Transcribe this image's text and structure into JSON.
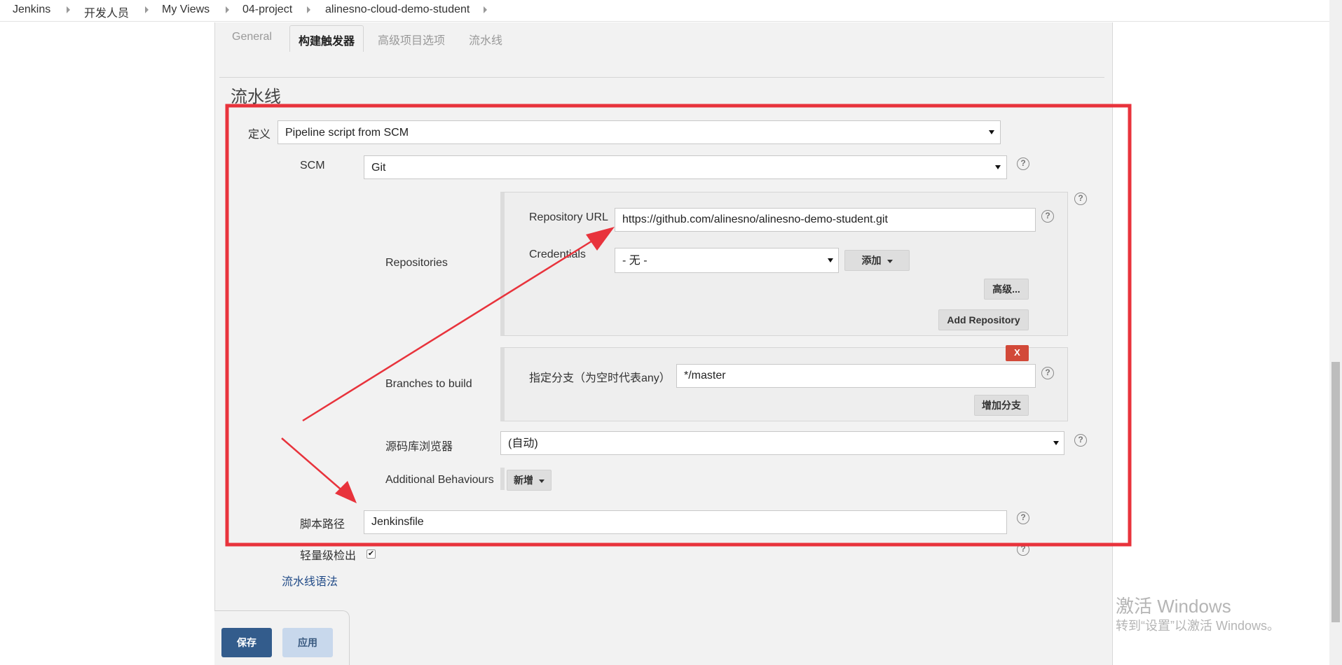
{
  "breadcrumb": [
    "Jenkins",
    "开发人员",
    "My Views",
    "04-project",
    "alinesno-cloud-demo-student"
  ],
  "tabs": [
    {
      "label": "General",
      "active": false
    },
    {
      "label": "构建触发器",
      "active": true
    },
    {
      "label": "高级项目选项",
      "active": false
    },
    {
      "label": "流水线",
      "active": false
    }
  ],
  "section_title": "流水线",
  "definition": {
    "label": "定义",
    "value": "Pipeline script from SCM"
  },
  "scm": {
    "label": "SCM",
    "value": "Git"
  },
  "repositories": {
    "label": "Repositories",
    "url_label": "Repository URL",
    "url_value": "https://github.com/alinesno/alinesno-demo-student.git",
    "credentials_label": "Credentials",
    "credentials_value": "- 无 -",
    "add_button": "添加",
    "advanced_button": "高级...",
    "add_repository_button": "Add Repository"
  },
  "branches": {
    "label": "Branches to build",
    "delete_button": "X",
    "branch_label": "指定分支（为空时代表any）",
    "branch_value": "*/master",
    "add_branch_button": "增加分支"
  },
  "repo_browser": {
    "label": "源码库浏览器",
    "value": "(自动)"
  },
  "additional_behaviours": {
    "label": "Additional Behaviours",
    "button": "新增"
  },
  "script_path": {
    "label": "脚本路径",
    "value": "Jenkinsfile"
  },
  "lightweight_checkout": {
    "label": "轻量级检出",
    "checked": true
  },
  "pipeline_syntax_link": "流水线语法",
  "bottom": {
    "save": "保存",
    "apply": "应用"
  },
  "help_icon_glyph": "?",
  "checkmark_glyph": "✔",
  "watermark": {
    "title": "激活 Windows",
    "subtitle": "转到“设置”以激活 Windows。"
  },
  "colors": {
    "annotation_red": "#e8333c",
    "link": "#204a87",
    "save_button": "#335c8c",
    "delete_button": "#d24939"
  }
}
